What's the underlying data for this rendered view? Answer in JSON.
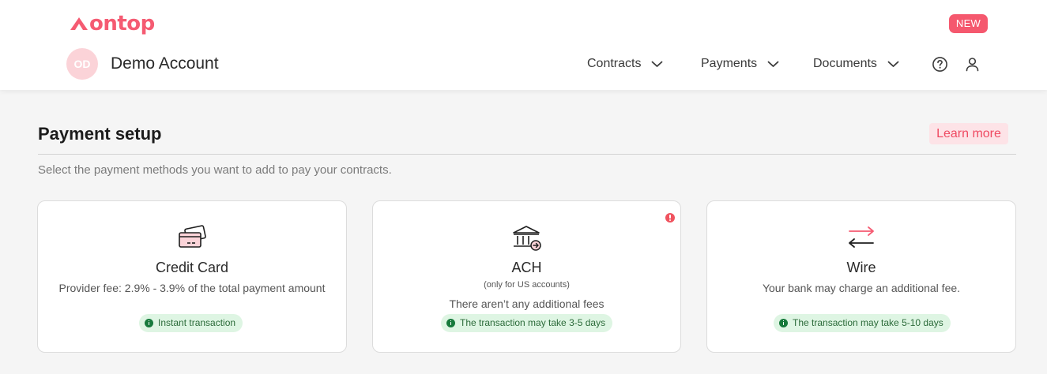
{
  "brand": {
    "name": "ontop",
    "color": "#f55b72"
  },
  "header": {
    "new_badge": "NEW",
    "avatar_initials": "OD",
    "account_name": "Demo Account",
    "nav": [
      {
        "label": "Contracts",
        "icon": "chevron-down-icon"
      },
      {
        "label": "Payments",
        "icon": "chevron-down-icon"
      },
      {
        "label": "Documents",
        "icon": "chevron-down-icon"
      }
    ],
    "icons": [
      "help-icon",
      "user-icon"
    ]
  },
  "page": {
    "title": "Payment setup",
    "learn_more": "Learn more",
    "subtitle": "Select the payment methods you want to add to pay your contracts."
  },
  "methods": [
    {
      "title": "Credit Card",
      "icon": "credit-card-icon",
      "description": "Provider fee: 2.9% - 3.9% of the total payment amount",
      "badge": "Instant transaction"
    },
    {
      "title": "ACH",
      "icon": "bank-icon",
      "note": "(only for US accounts)",
      "description": "There aren’t any additional fees",
      "badge": "The transaction may take 3-5 days",
      "alert_icon": "alert-icon"
    },
    {
      "title": "Wire",
      "icon": "transfer-arrows-icon",
      "description": "Your bank may charge an additional fee.",
      "badge": "The transaction may take 5-10 days"
    }
  ],
  "colors": {
    "accent": "#f55b72",
    "success_bg": "#def5e3",
    "success_fg": "#177a3c",
    "page_bg": "#f5f5f5"
  }
}
